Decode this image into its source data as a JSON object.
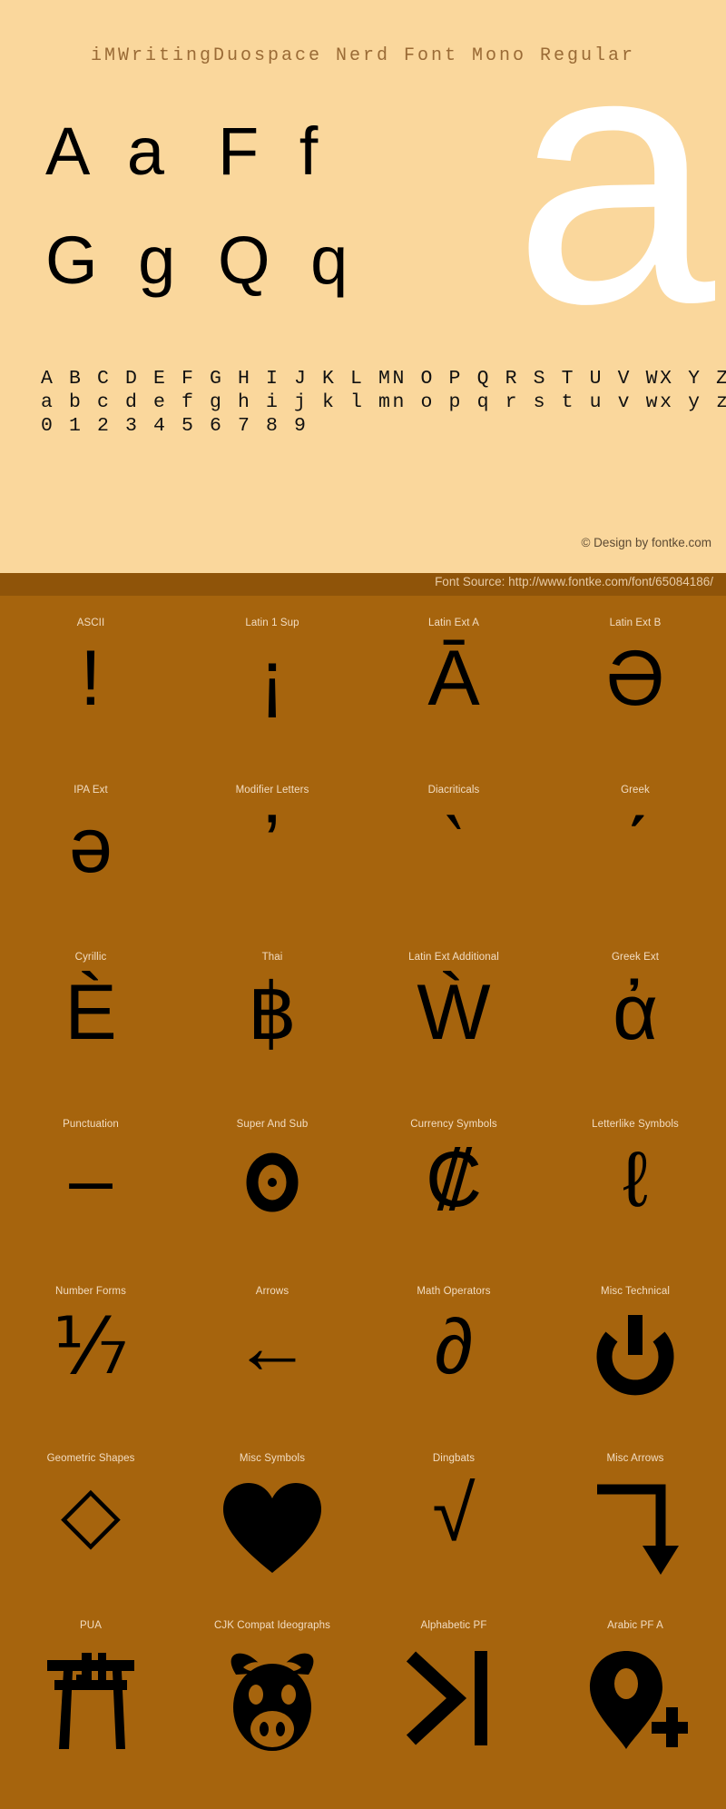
{
  "specimen": {
    "font_title": "iMWritingDuospace Nerd Font Mono Regular",
    "watermark_glyph": "a",
    "sample_pairs": [
      [
        "A a",
        "F f"
      ],
      [
        "G g",
        "Q q"
      ]
    ],
    "alphabet_rows": [
      "A B C D E F G H I J K L MN O P Q R S T U V WX Y Z",
      "a b c d e f g h i j k l mn o p q r s t u v wx y z",
      "0 1 2 3 4 5 6 7 8 9"
    ],
    "credit": "© Design by fontke.com",
    "source": "Font Source: http://www.fontke.com/font/65084186/",
    "colors": {
      "specimen_bg": "#fad79c",
      "title_text": "#9a6b36",
      "watermark": "#ffffff",
      "glyph_black": "#000000",
      "source_bar_bg": "#8f5409",
      "source_text": "#e8cba6",
      "grid_bg": "#a6640d",
      "grid_label": "#f2dcc1"
    }
  },
  "unicode_grid": {
    "rows": [
      [
        {
          "label": "ASCII",
          "glyph": "!",
          "glyph_name": "exclamation-mark-glyph"
        },
        {
          "label": "Latin 1 Sup",
          "glyph": "¡",
          "glyph_name": "inverted-exclamation-glyph"
        },
        {
          "label": "Latin Ext A",
          "glyph": "Ā",
          "glyph_name": "a-macron-glyph"
        },
        {
          "label": "Latin Ext B",
          "glyph": "Ə",
          "glyph_name": "schwa-capital-glyph"
        }
      ],
      [
        {
          "label": "IPA Ext",
          "glyph": "ə",
          "glyph_name": "schwa-small-glyph"
        },
        {
          "label": "Modifier Letters",
          "glyph": "ʼ",
          "glyph_name": "modifier-apostrophe-glyph"
        },
        {
          "label": "Diacriticals",
          "glyph": "̀",
          "glyph_name": "combining-grave-accent-glyph"
        },
        {
          "label": "Greek",
          "glyph": "ʹ",
          "glyph_name": "greek-numeral-sign-glyph"
        }
      ],
      [
        {
          "label": "Cyrillic",
          "glyph": "Ѐ",
          "glyph_name": "cyrillic-ie-grave-glyph"
        },
        {
          "label": "Thai",
          "glyph": "฿",
          "glyph_name": "thai-baht-glyph"
        },
        {
          "label": "Latin Ext Additional",
          "glyph": "Ẁ",
          "glyph_name": "w-grave-glyph"
        },
        {
          "label": "Greek Ext",
          "glyph": "ἀ",
          "glyph_name": "greek-alpha-psili-glyph"
        }
      ],
      [
        {
          "label": "Punctuation",
          "glyph": "–",
          "glyph_name": "en-dash-glyph"
        },
        {
          "label": "Super And Sub",
          "glyph": "⁰",
          "glyph_name": "superscript-zero-glyph"
        },
        {
          "label": "Currency Symbols",
          "glyph": "₡",
          "glyph_name": "colon-currency-glyph"
        },
        {
          "label": "Letterlike Symbols",
          "glyph": "ℓ",
          "glyph_name": "script-small-l-glyph"
        }
      ],
      [
        {
          "label": "Number Forms",
          "glyph": "⅐",
          "glyph_name": "fraction-one-seventh-glyph"
        },
        {
          "label": "Arrows",
          "glyph": "←",
          "glyph_name": "leftwards-arrow-glyph"
        },
        {
          "label": "Math Operators",
          "glyph": "∂",
          "glyph_name": "partial-differential-glyph"
        },
        {
          "label": "Misc Technical",
          "glyph": "⏻",
          "glyph_name": "power-symbol-glyph"
        }
      ],
      [
        {
          "label": "Geometric Shapes",
          "glyph": "◇",
          "glyph_name": "white-diamond-glyph"
        },
        {
          "label": "Misc Symbols",
          "glyph": "♥",
          "glyph_name": "black-heart-suit-glyph"
        },
        {
          "label": "Dingbats",
          "glyph": "√",
          "glyph_name": "check-root-glyph"
        },
        {
          "label": "Misc Arrows",
          "glyph": "⬎",
          "glyph_name": "arrow-right-then-down-glyph"
        }
      ],
      [
        {
          "label": "PUA",
          "glyph": "",
          "glyph_name": "torii-gate-glyph"
        },
        {
          "label": "CJK Compat Ideographs",
          "glyph": "",
          "glyph_name": "pig-face-glyph"
        },
        {
          "label": "Alphabetic PF",
          "glyph": "",
          "glyph_name": "chevron-right-bar-glyph"
        },
        {
          "label": "Arabic PF A",
          "glyph": "",
          "glyph_name": "map-marker-plus-glyph"
        }
      ]
    ]
  }
}
